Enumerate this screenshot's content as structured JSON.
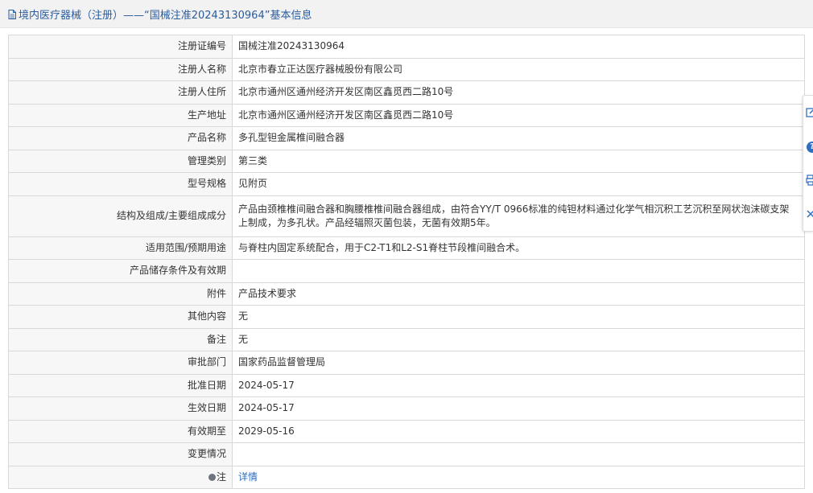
{
  "header": {
    "title": "境内医疗器械（注册）——“国械注准20243130964”基本信息"
  },
  "rows": [
    {
      "label": "注册证编号",
      "value": "国械注准20243130964"
    },
    {
      "label": "注册人名称",
      "value": "北京市春立正达医疗器械股份有限公司"
    },
    {
      "label": "注册人住所",
      "value": "北京市通州区通州经济开发区南区鑫觅西二路10号"
    },
    {
      "label": "生产地址",
      "value": "北京市通州区通州经济开发区南区鑫觅西二路10号"
    },
    {
      "label": "产品名称",
      "value": "多孔型钽金属椎间融合器"
    },
    {
      "label": "管理类别",
      "value": "第三类"
    },
    {
      "label": "型号规格",
      "value": "见附页"
    },
    {
      "label": "结构及组成/主要组成成分",
      "value": "产品由颈椎椎间融合器和胸腰椎椎间融合器组成，由符合YY/T 0966标准的纯钽材料通过化学气相沉积工艺沉积至网状泡沫碳支架上制成，为多孔状。产品经辐照灭菌包装，无菌有效期5年。"
    },
    {
      "label": "适用范围/预期用途",
      "value": "与脊柱内固定系统配合，用于C2-T1和L2-S1脊柱节段椎间融合术。"
    },
    {
      "label": "产品储存条件及有效期",
      "value": ""
    },
    {
      "label": "附件",
      "value": "产品技术要求"
    },
    {
      "label": "其他内容",
      "value": "无"
    },
    {
      "label": "备注",
      "value": "无"
    },
    {
      "label": "审批部门",
      "value": "国家药品监督管理局"
    },
    {
      "label": "批准日期",
      "value": "2024-05-17"
    },
    {
      "label": "生效日期",
      "value": "2024-05-17"
    },
    {
      "label": "有效期至",
      "value": "2029-05-16"
    },
    {
      "label": "变更情况",
      "value": ""
    },
    {
      "label": "注",
      "value": "详情"
    }
  ],
  "side_panel": {
    "icons": [
      "edit-icon",
      "help-icon",
      "print-icon",
      "close-icon"
    ],
    "help_glyph": "?"
  },
  "colors": {
    "link": "#2b6cc4",
    "title": "#2b5c9e",
    "header_bg": "#f2f2f2",
    "label_bg": "#f7f7f7",
    "border": "#d8d8d8"
  }
}
